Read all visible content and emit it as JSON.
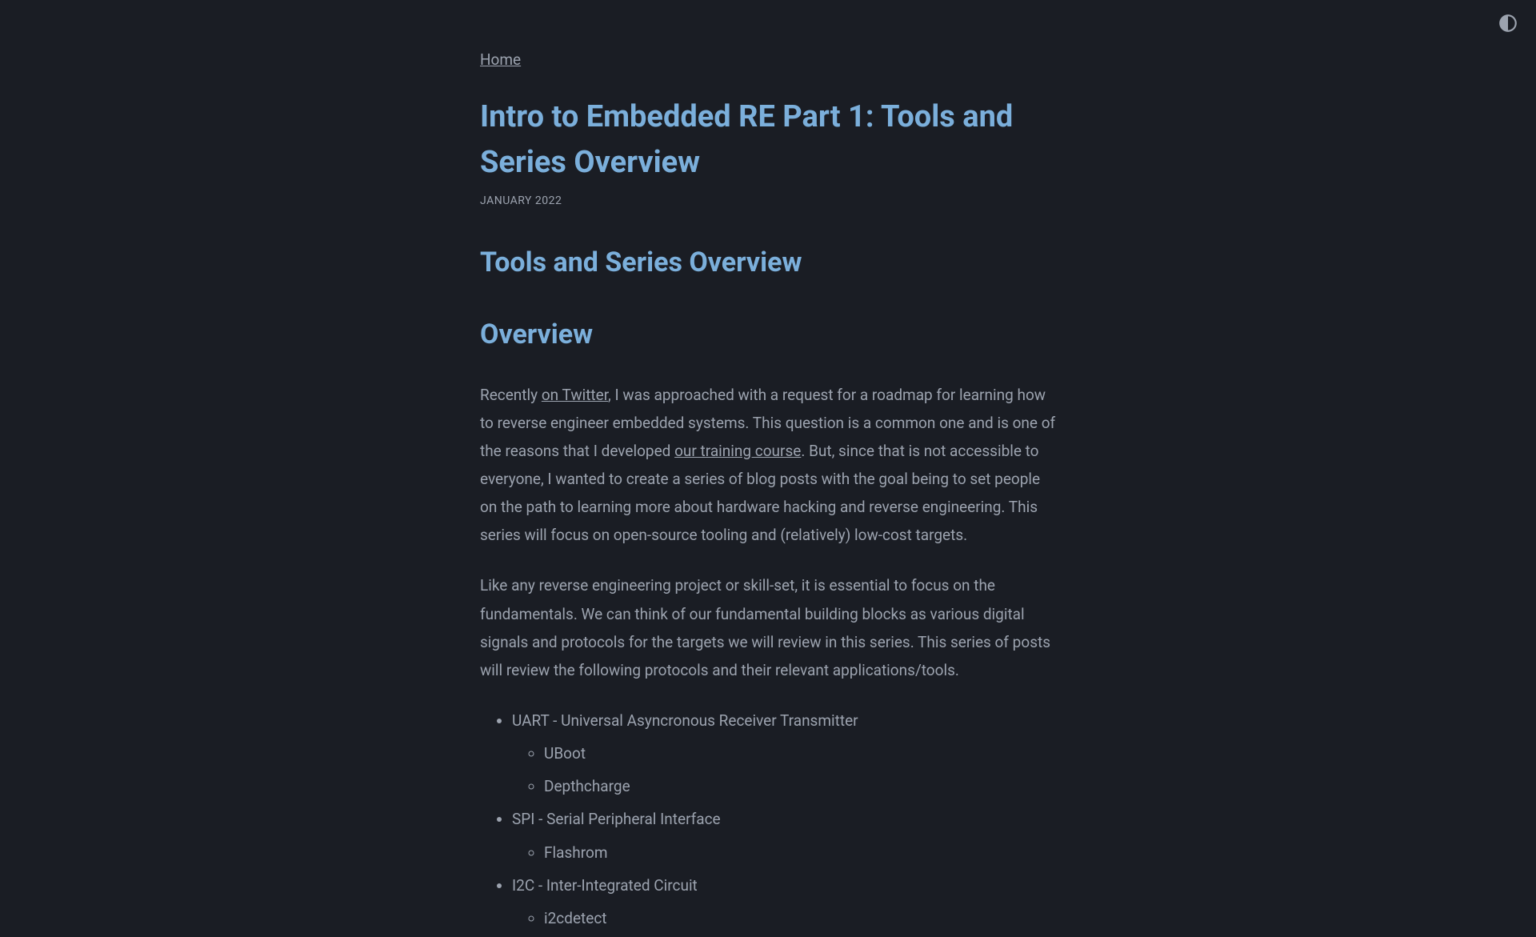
{
  "breadcrumb": {
    "home": "Home"
  },
  "page": {
    "title": "Intro to Embedded RE Part 1: Tools and Series Overview",
    "date": "JANUARY 2022"
  },
  "section": {
    "tools_title": "Tools and Series Overview",
    "overview_title": "Overview"
  },
  "paragraph1": {
    "pre": "Recently ",
    "link1": "on Twitter",
    "mid": ", I was approached with a request for a roadmap for learning how to reverse engineer embedded systems. This question is a common one and is one of the reasons that I developed ",
    "link2": "our training course",
    "post": ". But, since that is not accessible to everyone, I wanted to create a series of blog posts with the goal being to set people on the path to learning more about hardware hacking and reverse engineering. This series will focus on open-source tooling and (relatively) low-cost targets."
  },
  "paragraph2": "Like any reverse engineering project or skill-set, it is essential to focus on the fundamentals. We can think of our fundamental building blocks as various digital signals and protocols for the targets we will review in this series. This series of posts will review the following protocols and their relevant applications/tools.",
  "list": {
    "uart": "UART - Universal Asyncronous Receiver Transmitter",
    "uboot": "UBoot",
    "depthcharge": "Depthcharge",
    "spi": "SPI - Serial Peripheral Interface",
    "flashrom": "Flashrom",
    "i2c": "I2C - Inter-Integrated Circuit",
    "i2cdetect": "i2cdetect"
  }
}
